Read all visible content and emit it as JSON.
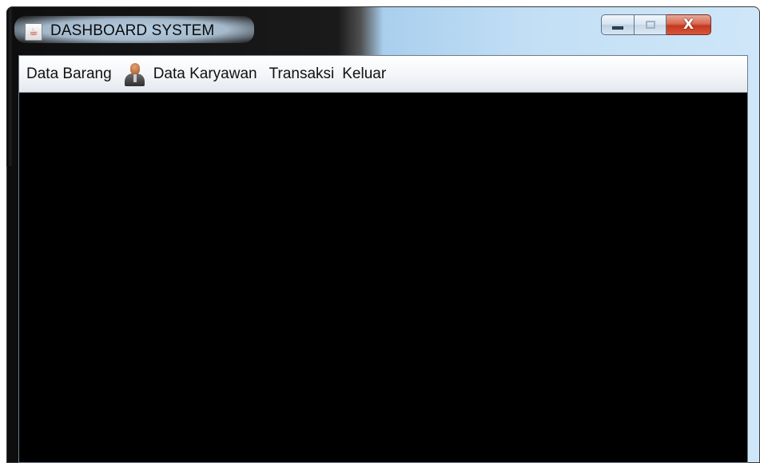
{
  "window": {
    "title": "DASHBOARD SYSTEM",
    "app_icon": "java-icon",
    "controls": {
      "minimize_icon": "minimize-icon",
      "maximize_icon": "maximize-icon",
      "close_icon": "close-icon",
      "close_glyph": "X"
    }
  },
  "menubar": {
    "items": [
      {
        "label": "Data Barang"
      },
      {
        "label": "Data Karyawan",
        "icon": "user-icon"
      },
      {
        "label": "Transaksi"
      },
      {
        "label": "Keluar"
      }
    ]
  },
  "colors": {
    "content_background": "#000000",
    "close_button": "#c4391f",
    "menubar_background": "#f3f5f8"
  }
}
